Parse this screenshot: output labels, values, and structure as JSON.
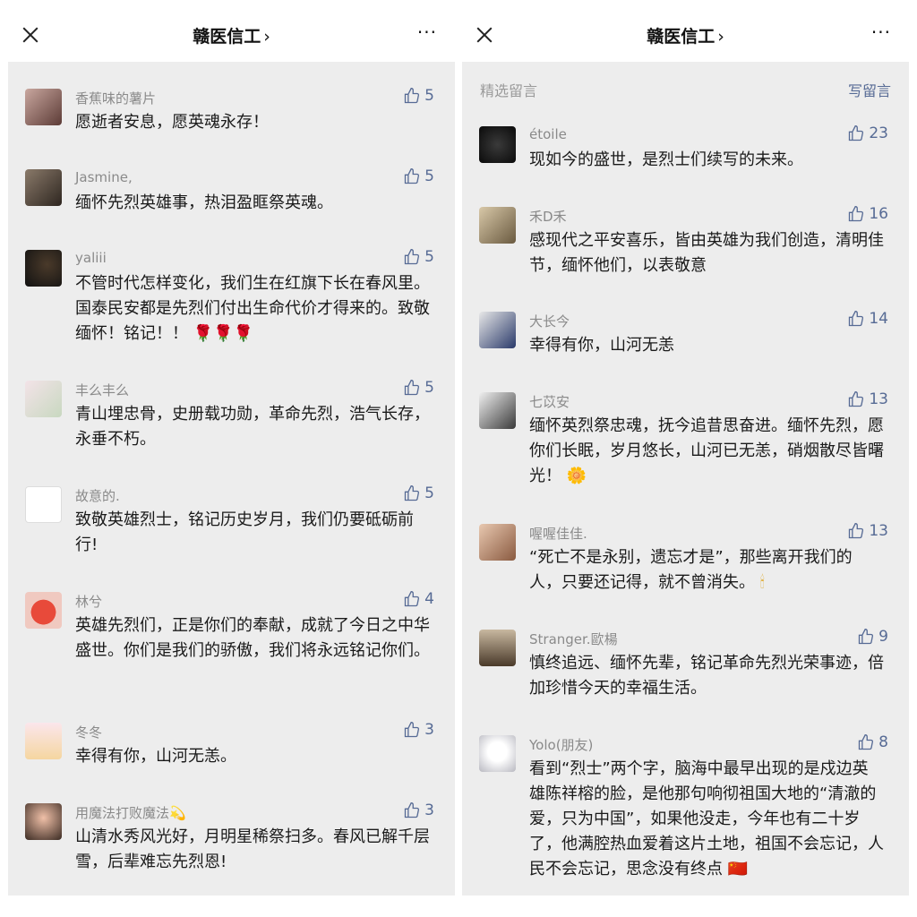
{
  "left": {
    "title": "赣医信工",
    "chevron": "›",
    "more": "···",
    "comments": [
      {
        "name": "香蕉味的薯片",
        "likes": "5",
        "text": "愿逝者安息，愿英魂永存！"
      },
      {
        "name": "Jasmine,",
        "likes": "5",
        "text": "缅怀先烈英雄事，热泪盈眶祭英魂。"
      },
      {
        "name": "yaliii",
        "likes": "5",
        "text": "不管时代怎样变化，我们生在红旗下长在春风里。国泰民安都是先烈们付出生命代价才得来的。致敬缅怀！铭记！！",
        "emoji": "🌹🌹🌹"
      },
      {
        "name": "丰么丰么",
        "likes": "5",
        "text": "青山埋忠骨，史册载功勋，革命先烈，浩气长存，永垂不朽。"
      },
      {
        "name": "故意的.",
        "likes": "5",
        "text": "致敬英雄烈士，铭记历史岁月，我们仍要砥砺前行!"
      },
      {
        "name": "林兮",
        "likes": "4",
        "text": "英雄先烈们，正是你们的奉献，成就了今日之中华盛世。你们是我们的骄傲，我们将永远铭记你们。"
      },
      {
        "name": "冬冬",
        "likes": "3",
        "text": "幸得有你，山河无恙。"
      },
      {
        "name": "用魔法打败魔法",
        "likes": "3",
        "text": "山清水秀风光好，月明星稀祭扫多。春风已解千层雪，后辈难忘先烈恩!",
        "name_emoji": "💫"
      }
    ]
  },
  "right": {
    "title": "赣医信工",
    "chevron": "›",
    "more": "···",
    "section_label": "精选留言",
    "write_label": "写留言",
    "comments": [
      {
        "name": "étoile",
        "likes": "23",
        "text": "现如今的盛世，是烈士们续写的未来。"
      },
      {
        "name": "禾D禾",
        "likes": "16",
        "text": "感现代之平安喜乐，皆由英雄为我们创造，清明佳节，缅怀他们，以表敬意"
      },
      {
        "name": "大长今",
        "likes": "14",
        "text": "幸得有你，山河无恙"
      },
      {
        "name": "七苡安",
        "likes": "13",
        "text": "缅怀英烈祭忠魂，抚今追昔思奋进。缅怀先烈，愿你们长眠，岁月悠长，山河已无恙，硝烟散尽皆曙光！",
        "emoji": "🌼"
      },
      {
        "name": "喔喔佳佳.",
        "likes": "13",
        "text": "“死亡不是永别，遗忘才是”，那些离开我们的人，只要还记得，就不曾消失。",
        "emoji": "🕯"
      },
      {
        "name": "Stranger.歐楊",
        "likes": "9",
        "text": "慎终追远、缅怀先辈，铭记革命先烈光荣事迹，倍加珍惜今天的幸福生活。"
      },
      {
        "name": "Yolo(朋友)",
        "likes": "8",
        "text": "看到“烈士”两个字，脑海中最早出现的是戍边英雄陈祥榕的脸，是他那句响彻祖国大地的“清澈的爱，只为中国”，如果他没走，今年也有二十岁了，他满腔热血爱着这片土地，祖国不会忘记，人民不会忘记，思念没有终点",
        "emoji": "🇨🇳"
      }
    ]
  },
  "colors": {
    "link": "#576b95",
    "name": "#8a8a8a",
    "bg": "#ededed"
  }
}
